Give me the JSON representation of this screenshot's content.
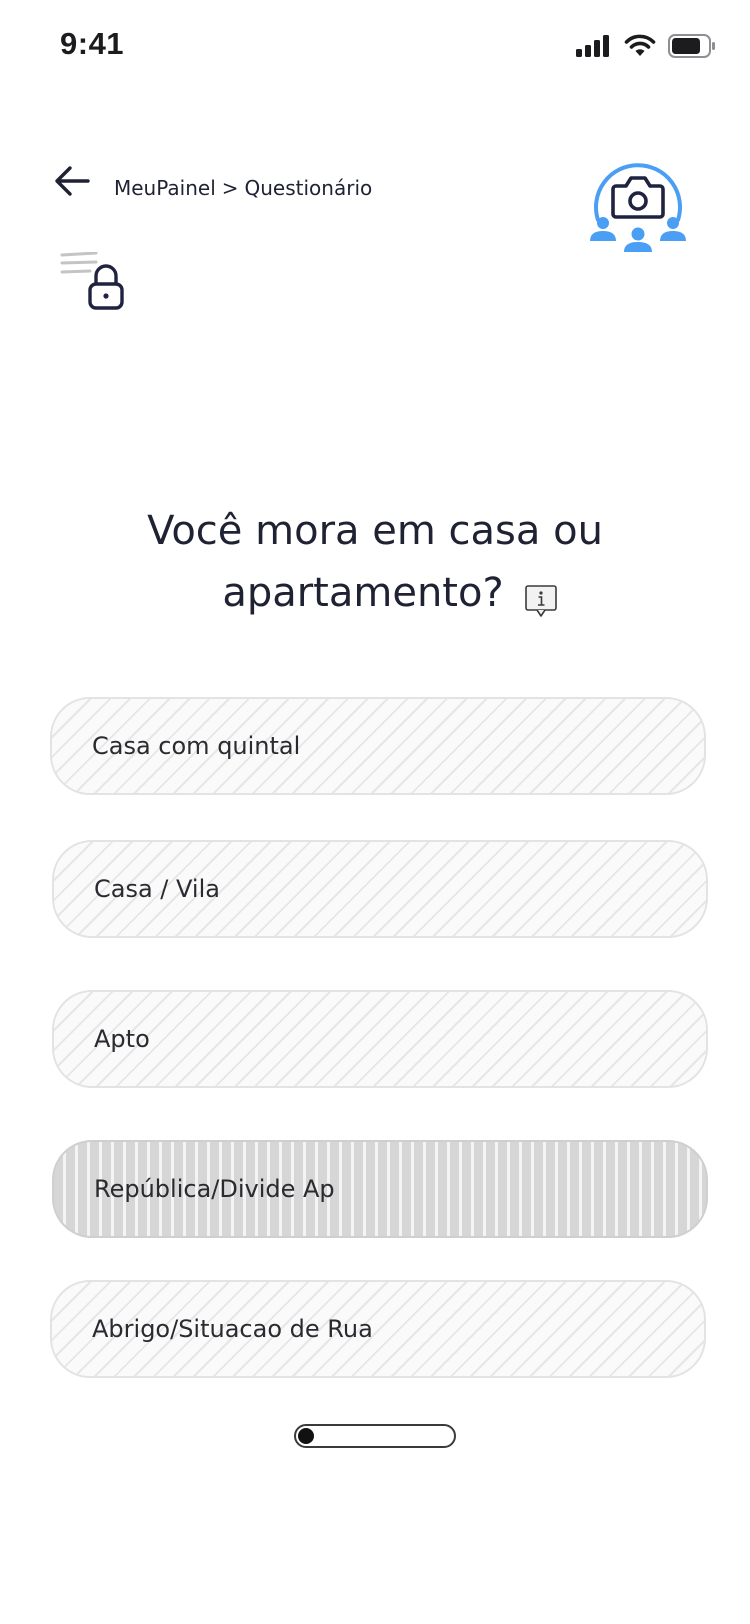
{
  "status_bar": {
    "time": "9:41",
    "icons": [
      "cellular-signal-icon",
      "wifi-icon",
      "battery-icon"
    ]
  },
  "header": {
    "breadcrumb": {
      "root": "MeuPainel",
      "separator": ">",
      "current": "Questionário"
    },
    "back_icon": "arrow-left-icon",
    "menu_icon": "locked-menu-icon",
    "camera_icon": "camera-group-icon"
  },
  "question": {
    "line1": "Você mora em casa ou",
    "line2": "apartamento?",
    "info_icon": "info-icon"
  },
  "options": [
    {
      "label": "Casa com quintal",
      "selected": false
    },
    {
      "label": "Casa / Vila",
      "selected": false
    },
    {
      "label": "Apto",
      "selected": false
    },
    {
      "label": "República/Divide Ap",
      "selected": true
    },
    {
      "label": "Abrigo/Situacao de Rua",
      "selected": false
    }
  ],
  "progress": {
    "value": 0.05
  },
  "colors": {
    "accent_blue": "#4a9ff5",
    "icon_dark": "#1f2340",
    "text": "#1f2233"
  }
}
